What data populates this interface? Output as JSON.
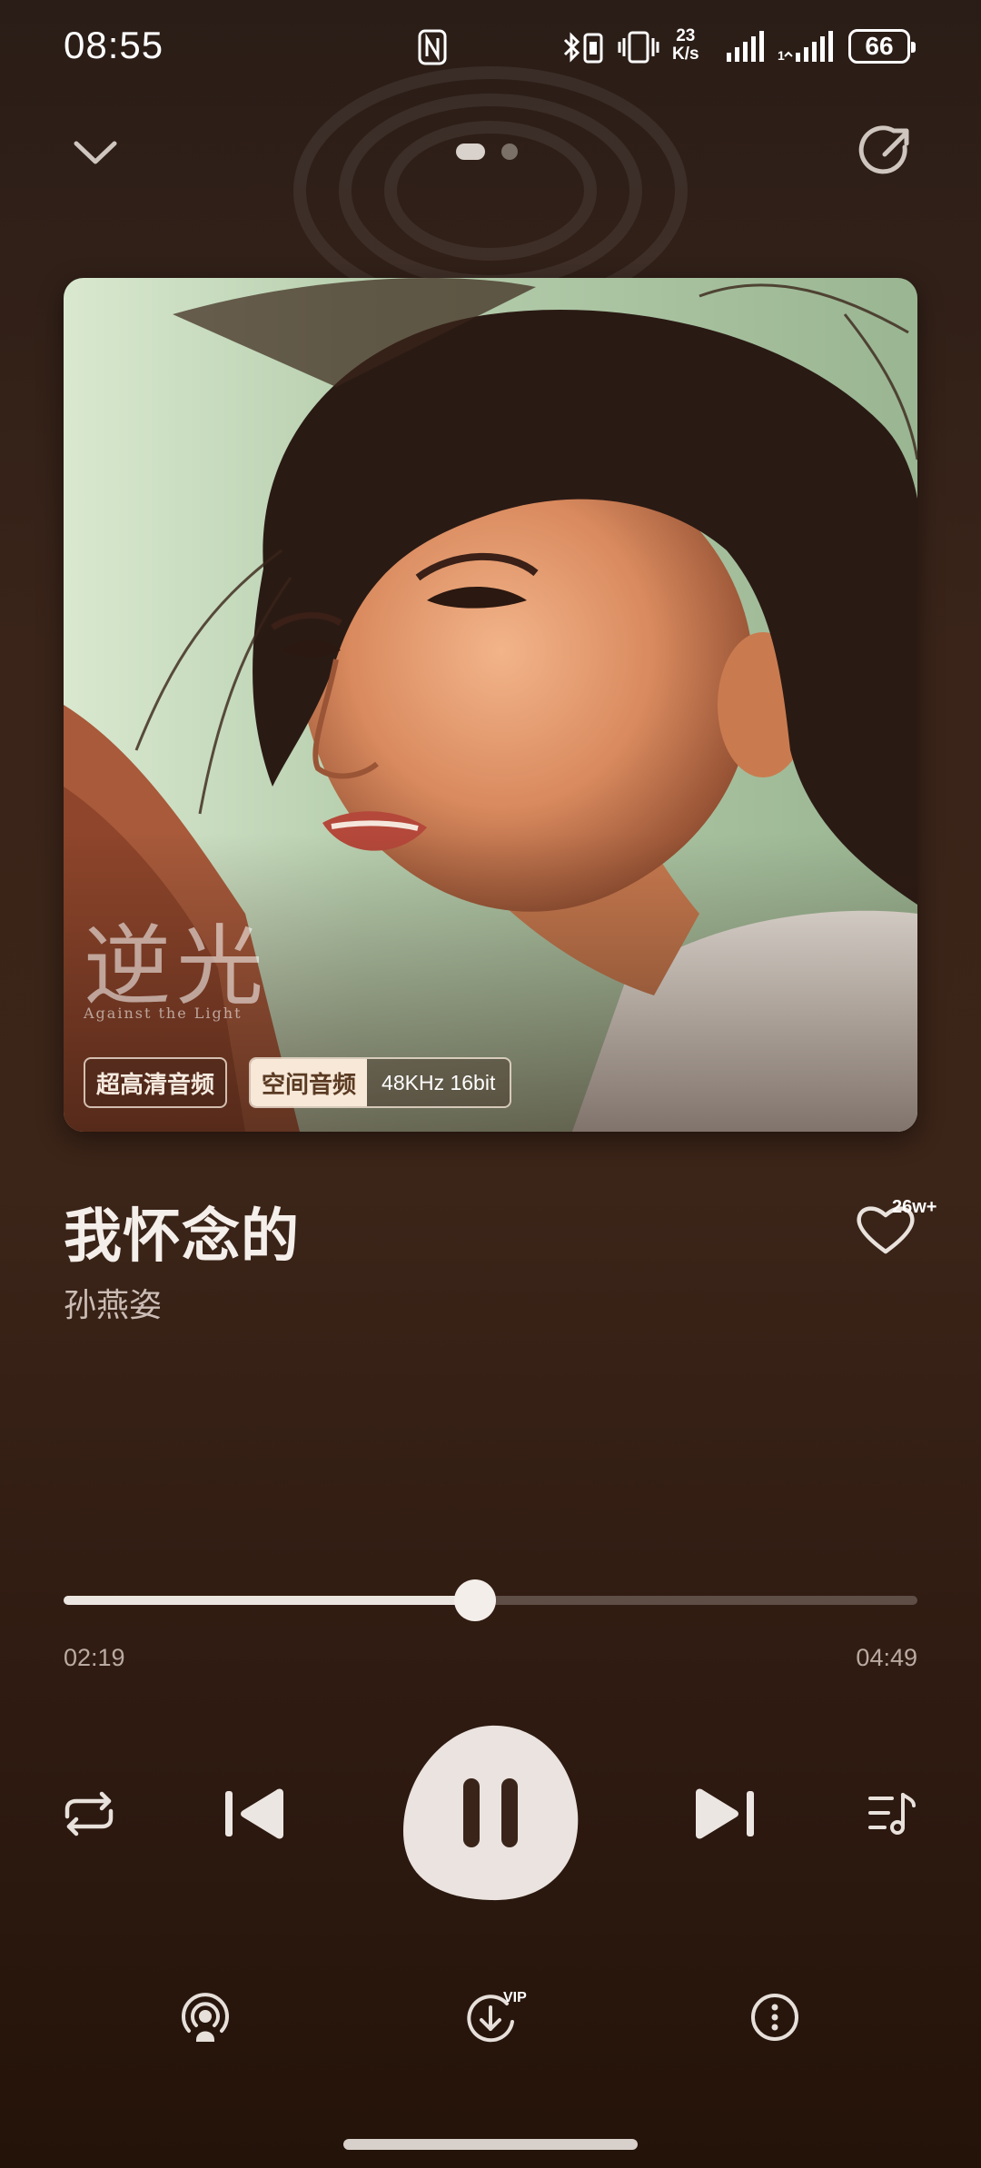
{
  "status_bar": {
    "time": "08:55",
    "net_speed_value": "23",
    "net_speed_unit": "K/s",
    "battery": "66",
    "icons": [
      "nfc-icon",
      "bluetooth-icon",
      "vibrate-icon",
      "network-speed",
      "signal-icon",
      "signal-icon-2",
      "battery-icon"
    ]
  },
  "header": {
    "icons": [
      "chevron-down-icon",
      "share-icon"
    ],
    "page_count": 2,
    "active_page": 0
  },
  "album": {
    "brand_text": "逆光",
    "brand_subtitle": "Against the Light",
    "badges": {
      "hq": "超高清音频",
      "spatial": "空间音频",
      "format": "48KHz  16bit"
    }
  },
  "song": {
    "title": "我怀念的",
    "artist": "孙燕姿",
    "like_count": "26w+"
  },
  "player": {
    "elapsed": "02:19",
    "total": "04:49",
    "progress_fraction": 0.482,
    "state": "playing"
  },
  "controls": {
    "icons": [
      "repeat-icon",
      "previous-icon",
      "pause-icon",
      "next-icon",
      "playlist-icon"
    ]
  },
  "bottom_bar": {
    "icons": [
      "cast-icon",
      "download-vip-icon",
      "more-icon"
    ],
    "vip_label": "VIP"
  },
  "colors": {
    "background_top": "#2a1d17",
    "background_mid": "#3b2418",
    "background_bottom": "#241309",
    "accent_light": "#f4eeea",
    "badge_highlight": "#f7e8d8"
  }
}
